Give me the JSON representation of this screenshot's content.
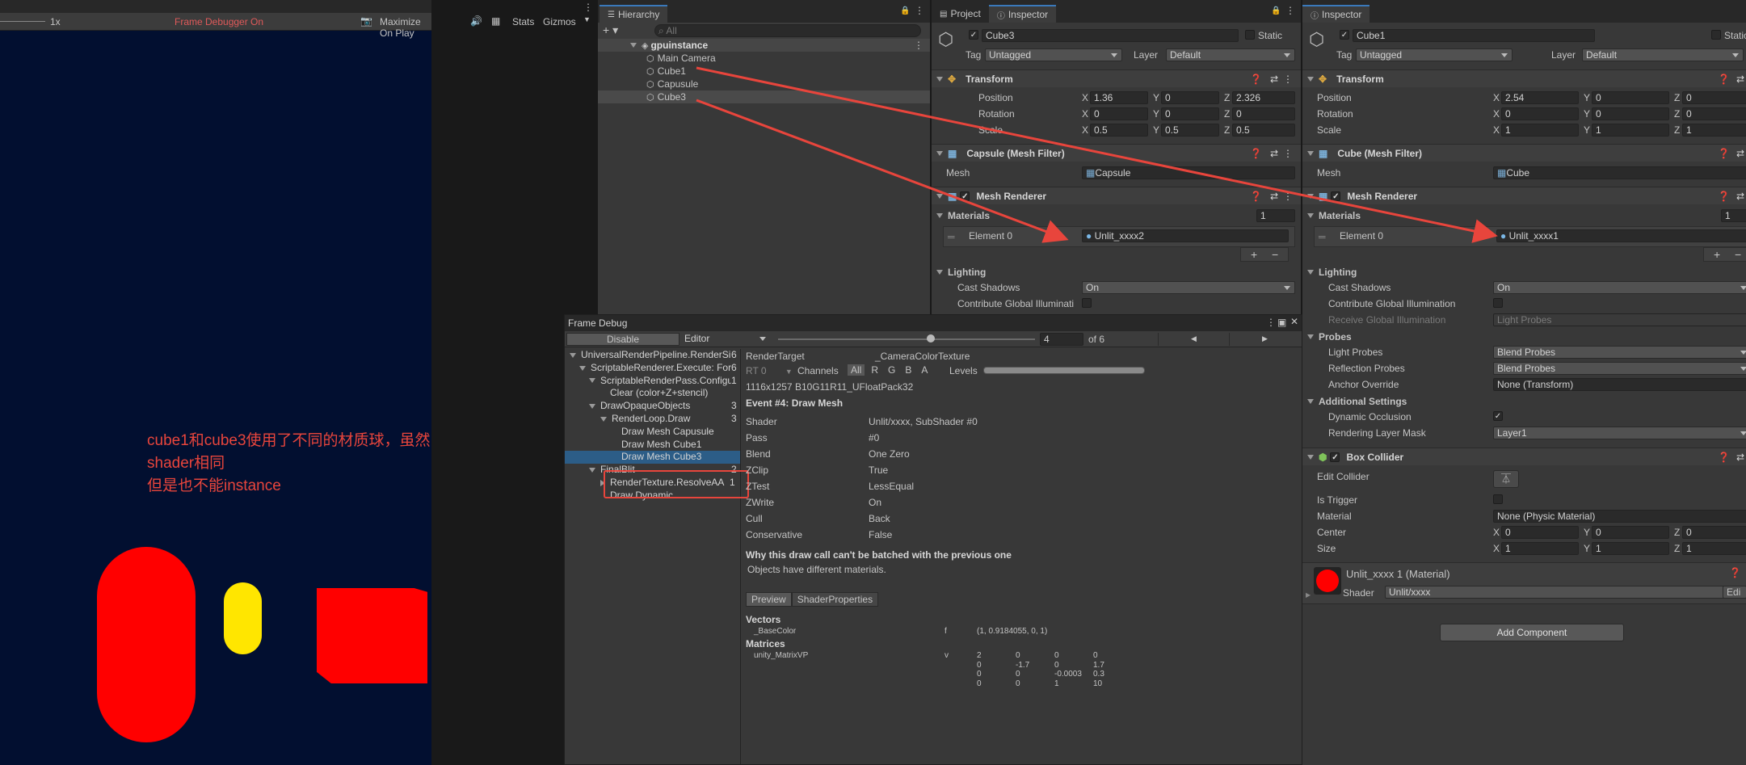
{
  "game_view": {
    "scale_label": "1x",
    "frame_debugger_status": "Frame Debugger On",
    "maximize_label": "Maximize On Play",
    "stats_label": "Stats",
    "gizmos_label": "Gizmos",
    "annotation_line1": "cube1和cube3使用了不同的材质球，虽然shader相同",
    "annotation_line2": "但是也不能instance",
    "background_color": "#020f30",
    "shape_color_capsule": "#ff0000",
    "shape_color_small_capsule": "#ffe600",
    "shape_color_cube": "#ff0000"
  },
  "hierarchy": {
    "tab_label": "Hierarchy",
    "search_placeholder": "All",
    "scene_name": "gpuinstance",
    "items": [
      "Main Camera",
      "Cube1",
      "Capusule",
      "Cube3"
    ]
  },
  "inspector_left": {
    "tab_project": "Project",
    "tab_inspector": "Inspector",
    "object_name": "Cube3",
    "static_label": "Static",
    "tag_label": "Tag",
    "tag_value": "Untagged",
    "layer_label": "Layer",
    "layer_value": "Default",
    "transform_title": "Transform",
    "position_label": "Position",
    "rotation_label": "Rotation",
    "scale_label": "Scale",
    "position": {
      "x": "1.36",
      "y": "0",
      "z": "2.326"
    },
    "rotation": {
      "x": "0",
      "y": "0",
      "z": "0"
    },
    "scale": {
      "x": "0.5",
      "y": "0.5",
      "z": "0.5"
    },
    "mesh_filter_title": "Capsule (Mesh Filter)",
    "mesh_label": "Mesh",
    "mesh_value": "Capsule",
    "mesh_renderer_title": "Mesh Renderer",
    "materials_label": "Materials",
    "materials_count": "1",
    "element0_label": "Element 0",
    "element0_value": "Unlit_xxxx2",
    "lighting_label": "Lighting",
    "cast_shadows_label": "Cast Shadows",
    "cast_shadows_value": "On",
    "contribute_gi_label": "Contribute Global Illuminati"
  },
  "inspector_right": {
    "tab_inspector": "Inspector",
    "object_name": "Cube1",
    "static_label": "Static",
    "tag_label": "Tag",
    "tag_value": "Untagged",
    "layer_label": "Layer",
    "layer_value": "Default",
    "transform_title": "Transform",
    "position_label": "Position",
    "rotation_label": "Rotation",
    "scale_label": "Scale",
    "position": {
      "x": "2.54",
      "y": "0",
      "z": "0"
    },
    "rotation": {
      "x": "0",
      "y": "0",
      "z": "0"
    },
    "scale": {
      "x": "1",
      "y": "1",
      "z": "1"
    },
    "mesh_filter_title": "Cube (Mesh Filter)",
    "mesh_label": "Mesh",
    "mesh_value": "Cube",
    "mesh_renderer_title": "Mesh Renderer",
    "materials_label": "Materials",
    "materials_count": "1",
    "element0_label": "Element 0",
    "element0_value": "Unlit_xxxx1",
    "lighting_label": "Lighting",
    "cast_shadows_label": "Cast Shadows",
    "cast_shadows_value": "On",
    "contribute_gi_label": "Contribute Global Illumination",
    "receive_gi_label": "Receive Global Illumination",
    "receive_gi_value": "Light Probes",
    "probes_label": "Probes",
    "light_probes_label": "Light Probes",
    "light_probes_value": "Blend Probes",
    "reflection_probes_label": "Reflection Probes",
    "reflection_probes_value": "Blend Probes",
    "anchor_override_label": "Anchor Override",
    "anchor_override_value": "None (Transform)",
    "additional_settings_label": "Additional Settings",
    "dynamic_occlusion_label": "Dynamic Occlusion",
    "rendering_layer_mask_label": "Rendering Layer Mask",
    "rendering_layer_mask_value": "Layer1",
    "box_collider_title": "Box Collider",
    "edit_collider_label": "Edit Collider",
    "is_trigger_label": "Is Trigger",
    "material_label": "Material",
    "material_value": "None (Physic Material)",
    "center_label": "Center",
    "center": {
      "x": "0",
      "y": "0",
      "z": "0"
    },
    "size_label": "Size",
    "size": {
      "x": "1",
      "y": "1",
      "z": "1"
    },
    "material_asset_name": "Unlit_xxxx 1 (Material)",
    "shader_label": "Shader",
    "shader_value": "Unlit/xxxx",
    "edit_label": "Edi",
    "add_component_label": "Add Component"
  },
  "frame_debug": {
    "tab_label": "Frame Debug",
    "disable_label": "Disable",
    "editor_label": "Editor",
    "event_value": "4",
    "of_label": "of 6",
    "tree": [
      {
        "label": "UniversalRenderPipeline.RenderSingleCamera: M",
        "count": "6",
        "indent": 0,
        "arrow": "down"
      },
      {
        "label": "ScriptableRenderer.Execute: ForwardRendere",
        "count": "6",
        "indent": 1,
        "arrow": "down"
      },
      {
        "label": "ScriptableRenderPass.Configure",
        "count": "1",
        "indent": 2,
        "arrow": "down"
      },
      {
        "label": "Clear (color+Z+stencil)",
        "count": "",
        "indent": 3,
        "arrow": ""
      },
      {
        "label": "DrawOpaqueObjects",
        "count": "3",
        "indent": 2,
        "arrow": "down"
      },
      {
        "label": "RenderLoop.Draw",
        "count": "3",
        "indent": 3,
        "arrow": "down"
      },
      {
        "label": "Draw Mesh Capusule",
        "count": "",
        "indent": 4,
        "arrow": ""
      },
      {
        "label": "Draw Mesh Cube1",
        "count": "",
        "indent": 4,
        "arrow": ""
      },
      {
        "label": "Draw Mesh Cube3",
        "count": "",
        "indent": 4,
        "arrow": "",
        "selected": true
      },
      {
        "label": "FinalBlit",
        "count": "2",
        "indent": 2,
        "arrow": "down"
      },
      {
        "label": "RenderTexture.ResolveAA",
        "count": "1",
        "indent": 3,
        "arrow": "right"
      },
      {
        "label": "Draw Dynamic",
        "count": "",
        "indent": 3,
        "arrow": ""
      }
    ],
    "render_target_label": "RenderTarget",
    "render_target_value": "_CameraColorTexture",
    "rt_label": "RT 0",
    "channels_label": "Channels",
    "channel_all": "All",
    "channel_r": "R",
    "channel_g": "G",
    "channel_b": "B",
    "channel_a": "A",
    "levels_label": "Levels",
    "format_line": "1116x1257 B10G11R11_UFloatPack32",
    "event_title": "Event #4: Draw Mesh",
    "props": [
      {
        "k": "Shader",
        "v": "Unlit/xxxx, SubShader #0"
      },
      {
        "k": "Pass",
        "v": "#0"
      },
      {
        "k": "Blend",
        "v": "One Zero"
      },
      {
        "k": "ZClip",
        "v": "True"
      },
      {
        "k": "ZTest",
        "v": "LessEqual"
      },
      {
        "k": "ZWrite",
        "v": "On"
      },
      {
        "k": "Cull",
        "v": "Back"
      },
      {
        "k": "Conservative",
        "v": "False"
      }
    ],
    "batch_title": "Why this draw call can't be batched with the previous one",
    "batch_reason": "Objects have different materials.",
    "tab_preview": "Preview",
    "tab_shader_props": "ShaderProperties",
    "vectors_label": "Vectors",
    "base_color_name": "_BaseColor",
    "base_color_stage": "f",
    "base_color_value": "(1, 0.9184055, 0, 1)",
    "matrices_label": "Matrices",
    "matrix_name": "unity_MatrixVP",
    "matrix_stage": "v",
    "matrix_rows": [
      [
        "2",
        "0",
        "0",
        "0"
      ],
      [
        "0",
        "-1.7",
        "0",
        "1.7"
      ],
      [
        "0",
        "0",
        "-0.0003",
        "0.3"
      ],
      [
        "0",
        "0",
        "1",
        "10"
      ]
    ]
  },
  "accent_color": "#e8453c"
}
